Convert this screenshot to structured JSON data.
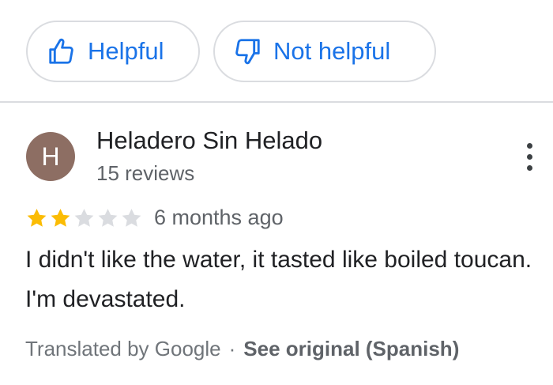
{
  "feedback": {
    "helpful_label": "Helpful",
    "not_helpful_label": "Not helpful",
    "accent_color": "#1a73e8"
  },
  "reviewer": {
    "avatar_initial": "H",
    "avatar_color": "#8d6e63",
    "name": "Heladero Sin Helado",
    "review_count": "15 reviews"
  },
  "review": {
    "rating": 2,
    "max_rating": 5,
    "star_filled_color": "#fbbc04",
    "star_empty_color": "#dadce0",
    "time_ago": "6 months ago",
    "text": "I didn't like the water, it tasted like boiled toucan. I'm devastated."
  },
  "translation": {
    "note": "Translated by Google",
    "separator": "·",
    "see_original_label": "See original (Spanish)"
  },
  "icons": {
    "helpful": "thumb-up-icon",
    "not_helpful": "thumb-down-icon",
    "more": "more-vert-icon",
    "star": "star-icon"
  }
}
